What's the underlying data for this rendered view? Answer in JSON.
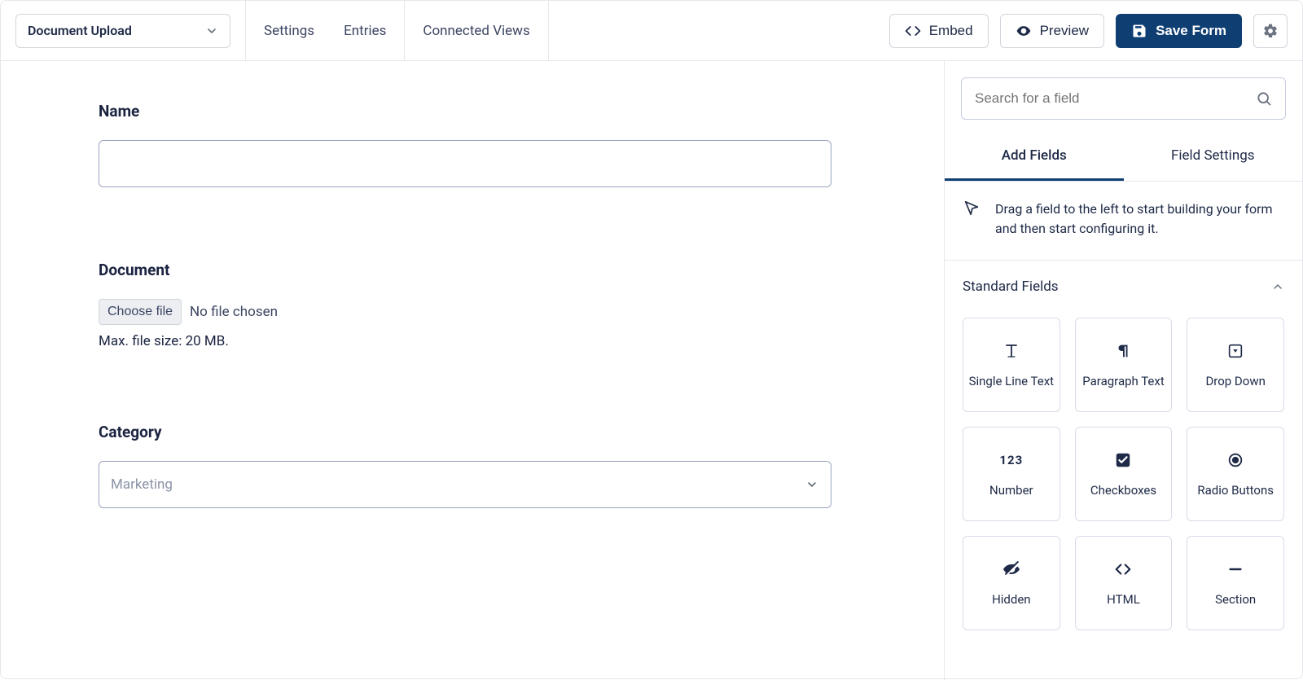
{
  "topbar": {
    "form_name": "Document Upload",
    "nav": {
      "settings": "Settings",
      "entries": "Entries",
      "connected_views": "Connected Views"
    },
    "embed": "Embed",
    "preview": "Preview",
    "save": "Save Form"
  },
  "canvas": {
    "name_label": "Name",
    "document_label": "Document",
    "choose_file": "Choose file",
    "no_file": "No file chosen",
    "file_help": "Max. file size: 20 MB.",
    "category_label": "Category",
    "category_value": "Marketing"
  },
  "side": {
    "search_placeholder": "Search for a field",
    "tab_add": "Add Fields",
    "tab_settings": "Field Settings",
    "hint": "Drag a field to the left to start building your form and then start configuring it.",
    "section_title": "Standard Fields",
    "fields": [
      {
        "label": "Single Line Text",
        "icon": "single-line-text"
      },
      {
        "label": "Paragraph Text",
        "icon": "paragraph-text"
      },
      {
        "label": "Drop Down",
        "icon": "drop-down"
      },
      {
        "label": "Number",
        "icon": "number"
      },
      {
        "label": "Checkboxes",
        "icon": "checkboxes"
      },
      {
        "label": "Radio Buttons",
        "icon": "radio-buttons"
      },
      {
        "label": "Hidden",
        "icon": "hidden"
      },
      {
        "label": "HTML",
        "icon": "html"
      },
      {
        "label": "Section",
        "icon": "section"
      }
    ]
  }
}
